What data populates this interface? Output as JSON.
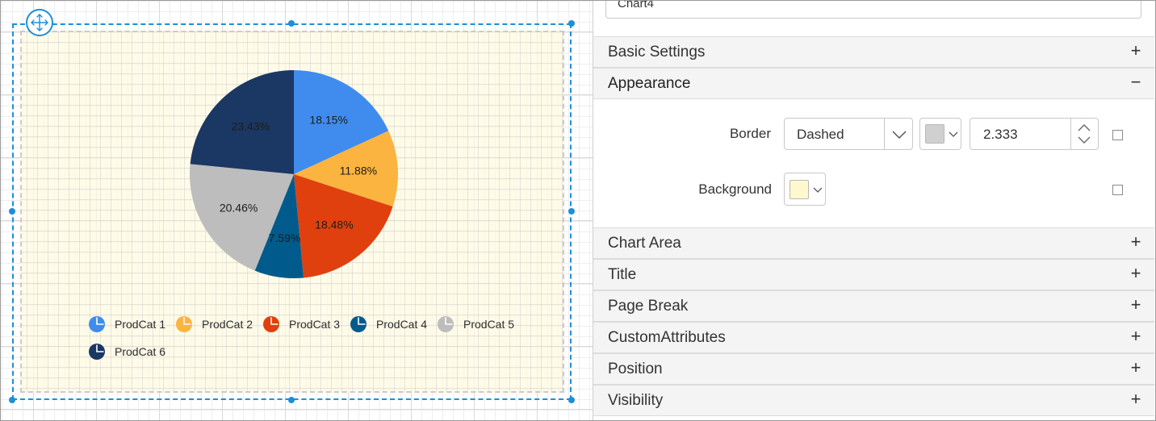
{
  "report_item": {
    "name_value": "Chart4"
  },
  "chart_data": {
    "type": "pie",
    "categories": [
      "ProdCat 1",
      "ProdCat 2",
      "ProdCat 3",
      "ProdCat 4",
      "ProdCat 5",
      "ProdCat 6"
    ],
    "values": [
      18.15,
      11.88,
      18.48,
      7.59,
      20.46,
      23.43
    ],
    "labels": [
      "18.15%",
      "11.88%",
      "18.48%",
      "7.59%",
      "20.46%",
      "23.43%"
    ],
    "colors": [
      "#3f8cee",
      "#fbb440",
      "#e0400e",
      "#005b8c",
      "#bdbdbd",
      "#1b3763"
    ],
    "legend_position": "bottom",
    "background": "#fffae0"
  },
  "panel": {
    "sections": {
      "basic_settings": {
        "label": "Basic Settings",
        "toggle": "+"
      },
      "appearance": {
        "label": "Appearance",
        "toggle": "−"
      },
      "chart_area": {
        "label": "Chart Area",
        "toggle": "+"
      },
      "title": {
        "label": "Title",
        "toggle": "+"
      },
      "page_break": {
        "label": "Page Break",
        "toggle": "+"
      },
      "custom_attributes": {
        "label": "CustomAttributes",
        "toggle": "+"
      },
      "position": {
        "label": "Position",
        "toggle": "+"
      },
      "visibility": {
        "label": "Visibility",
        "toggle": "+"
      }
    },
    "appearance": {
      "border_label": "Border",
      "border_style": "Dashed",
      "border_color": "#d0d0d0",
      "border_width": "2.333",
      "background_label": "Background",
      "background_color": "#fff8cf"
    }
  },
  "icons": {
    "move": "move-arrows-icon",
    "dropdown": "chevron-down-icon",
    "spin_up": "chevron-up-icon",
    "spin_down": "chevron-down-icon"
  }
}
